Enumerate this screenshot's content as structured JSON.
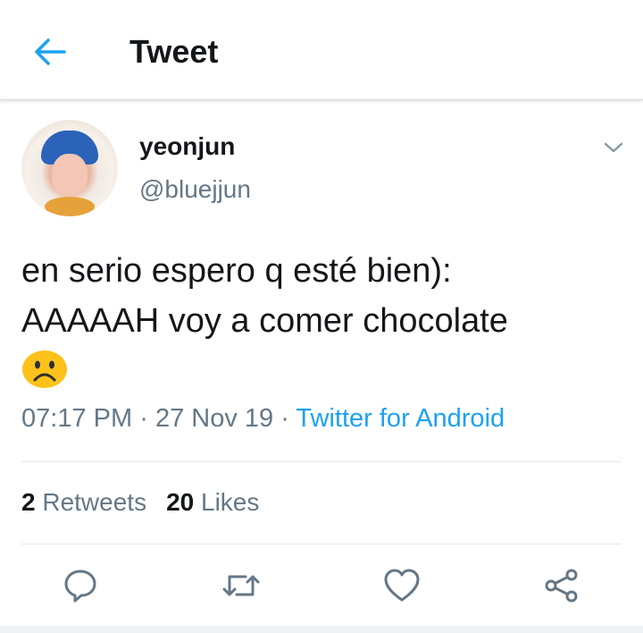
{
  "header": {
    "title": "Tweet",
    "back_icon": "arrow-left-icon"
  },
  "colors": {
    "accent": "#1da1f2",
    "text": "#14171a",
    "muted": "#657786",
    "divider": "#e1e8ed"
  },
  "tweet": {
    "display_name": "yeonjun",
    "handle": "@bluejjun",
    "text_lines": [
      "en serio espero q esté bien):",
      "AAAAAH voy a comer chocolate"
    ],
    "emoji": "frowning-face",
    "time": "07:17 PM",
    "date": "27 Nov 19",
    "separator": "·",
    "source": "Twitter for Android"
  },
  "stats": {
    "retweets_count": "2",
    "retweets_label": "Retweets",
    "likes_count": "20",
    "likes_label": "Likes"
  },
  "actions": [
    "reply-icon",
    "retweet-icon",
    "like-icon",
    "share-icon"
  ]
}
